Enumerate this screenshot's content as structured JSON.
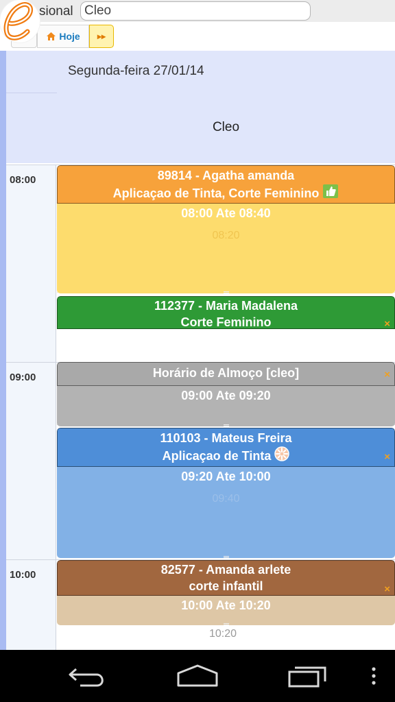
{
  "toolbar": {
    "professional_label": "sional",
    "professional_value": "Cleo",
    "today_label": "Hoje",
    "next_label": "▸▸"
  },
  "header": {
    "date": "Segunda-feira 27/01/14",
    "professional_column": "Cleo"
  },
  "time_labels": [
    "08:00",
    "09:00",
    "10:00"
  ],
  "events": [
    {
      "title": "89814 - Agatha amanda",
      "service": "Aplicaçao de Tinta, Corte Feminino",
      "time_range": "08:00 Ate 08:40",
      "slot_hint": "08:20",
      "icon": "thumbs-up-icon",
      "color": "#f7a23b",
      "body_color": "#fddc6d"
    },
    {
      "title": "112377 - Maria Madalena",
      "service": "Corte Feminino",
      "color": "#2e9a36",
      "close": "×"
    },
    {
      "title": "Horário de Almoço [cleo]",
      "time_range": "09:00 Ate 09:20",
      "color": "#a9a9a9",
      "body_color": "#b3b3b3",
      "close": "×"
    },
    {
      "title": "110103 - Mateus Freira",
      "service": "Aplicaçao de Tinta",
      "time_range": "09:20 Ate 10:00",
      "slot_hint": "09:40",
      "icon": "loading-icon",
      "color": "#4e8ed8",
      "body_color": "#82b1e6",
      "close": "×"
    },
    {
      "title": "82577 - Amanda arlete",
      "service": "corte infantil",
      "time_range": "10:00 Ate 10:20",
      "color": "#a1673f",
      "body_color": "#dec7a6",
      "close": "×"
    }
  ],
  "empty_slot_label": "10:20",
  "android_nav": [
    "back-icon",
    "home-icon",
    "recent-apps-icon",
    "menu-icon"
  ]
}
